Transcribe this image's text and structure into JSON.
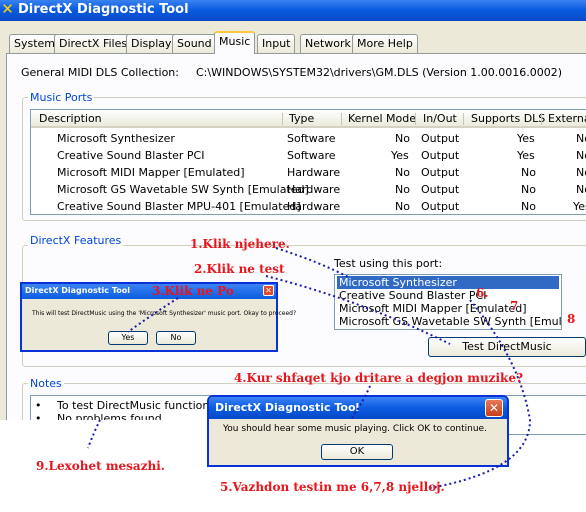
{
  "window": {
    "title": "DirectX Diagnostic Tool"
  },
  "tabs": [
    "System",
    "DirectX Files",
    "Display",
    "Sound",
    "Music",
    "Input",
    "Network",
    "More Help"
  ],
  "dls": {
    "label": "General MIDI DLS Collection:",
    "value": "C:\\WINDOWS\\SYSTEM32\\drivers\\GM.DLS (Version 1.00.0016.0002)"
  },
  "music_ports": {
    "group_label": "Music Ports",
    "columns": [
      "Description",
      "Type",
      "Kernel Mode",
      "In/Out",
      "Supports DLS",
      "Externa"
    ],
    "rows": [
      [
        "Microsoft Synthesizer",
        "Software",
        "No",
        "Output",
        "Yes",
        "No"
      ],
      [
        "Creative Sound Blaster PCI",
        "Software",
        "Yes",
        "Output",
        "Yes",
        "No"
      ],
      [
        "Microsoft MIDI Mapper [Emulated]",
        "Hardware",
        "No",
        "Output",
        "No",
        "No"
      ],
      [
        "Microsoft GS Wavetable SW Synth [Emulated]",
        "Hardware",
        "No",
        "Output",
        "No",
        "No"
      ],
      [
        "Creative Sound Blaster MPU-401 [Emulated]",
        "Hardware",
        "No",
        "Output",
        "No",
        "Yes"
      ]
    ]
  },
  "features": {
    "group_label": "DirectX Features",
    "test_label": "Test using this port:",
    "ports": [
      "Microsoft Synthesizer",
      "Creative Sound Blaster PCI",
      "Microsoft MIDI Mapper [Emulated]",
      "Microsoft GS Wavetable SW Synth [Emulated]"
    ],
    "test_button": "Test DirectMusic"
  },
  "notes": {
    "group_label": "Notes",
    "items": [
      "To test DirectMusic functionality",
      "No problems found."
    ]
  },
  "mini_dialog": {
    "title": "DirectX Diagnostic Tool",
    "message": "This will test DirectMusic using the 'Microsoft Synthesizer' music port.  Okay to proceed?",
    "yes": "Yes",
    "no": "No"
  },
  "dialog": {
    "title": "DirectX Diagnostic Tool",
    "message": "You should hear some music playing.  Click OK to continue.",
    "ok": "OK"
  },
  "annotations": {
    "a1": "1.Klik njehere.",
    "a2": "2.Klik ne test",
    "a3": "3.Klik ne Po",
    "a4": "4.Kur shfaqet kjo dritare a degjon muzike?",
    "a5": "5.Vazhdon testin me 6,7,8 njelloj.",
    "a6": "6.",
    "a7": "7",
    "a8": "8",
    "a9": "9.Lexohet mesazhi."
  },
  "colors": {
    "annotation": "#e8151b",
    "xp_blue": "#0a5ce0",
    "selection": "#316ac5",
    "group_label": "#0046d5"
  }
}
